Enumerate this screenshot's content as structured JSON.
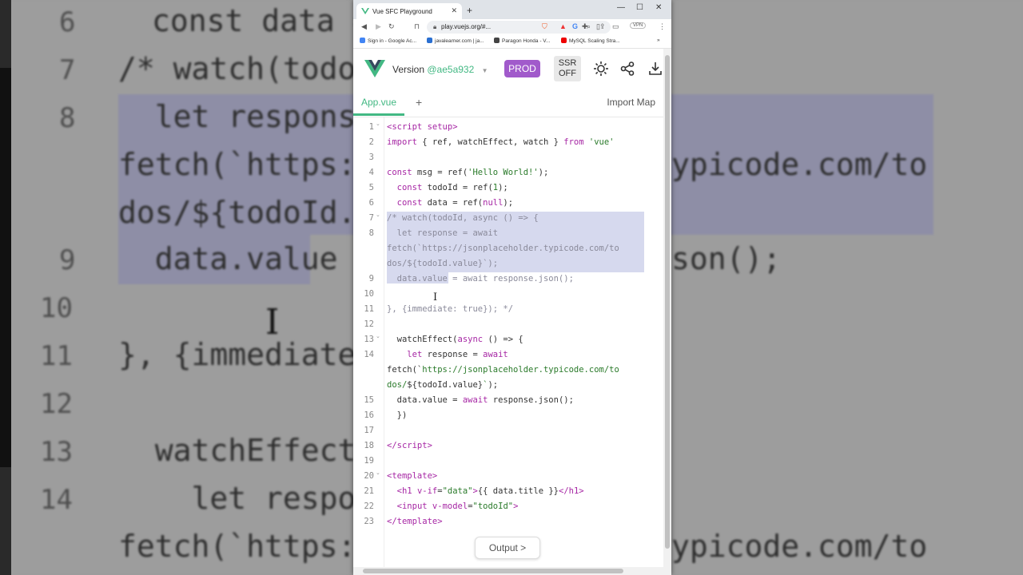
{
  "background": {
    "line_numbers": [
      "6",
      "7",
      "8",
      "9",
      "10",
      "11",
      "12",
      "13",
      "14"
    ],
    "lines": [
      "const data =",
      "/* watch(todoI",
      "  let respons",
      "fetch(`https:/",
      "dos/${todoId.v",
      "  data.value =",
      "}, {immediate",
      "  watchEffect",
      "    let respon",
      "fetch(`https:/"
    ],
    "right_lines": [
      "ypicode.com/to",
      "son();",
      "ypicode.com/to"
    ]
  },
  "browser": {
    "tab_title": "Vue SFC Playground",
    "url": "play.vuejs.org/#...",
    "vpn_label": "VPN",
    "bookmarks": [
      "Sign in - Google Ac...",
      "javalearner.com | ja...",
      "Paragon Honda - V...",
      "MySQL Scaling Stra..."
    ]
  },
  "header": {
    "version_label": "Version",
    "version_hash": "@ae5a932",
    "prod_label": "PROD",
    "ssr_line1": "SSR",
    "ssr_line2": "OFF"
  },
  "file_tabs": {
    "active": "App.vue",
    "add": "+",
    "import_map": "Import Map"
  },
  "editor": {
    "gutter": [
      "1",
      "2",
      "3",
      "4",
      "5",
      "6",
      "7",
      "8",
      "",
      "",
      "9",
      "10",
      "11",
      "12",
      "13",
      "14",
      "",
      "",
      "15",
      "16",
      "17",
      "18",
      "19",
      "20",
      "21",
      "22",
      "23"
    ]
  },
  "output_button": "Output >"
}
